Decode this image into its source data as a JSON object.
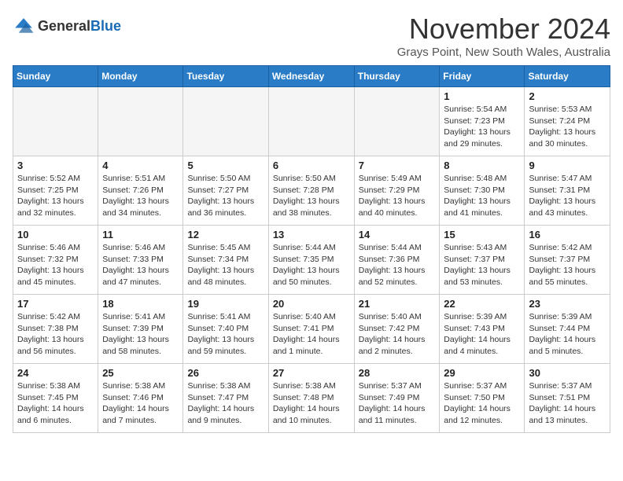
{
  "header": {
    "logo_general": "General",
    "logo_blue": "Blue",
    "month": "November 2024",
    "location": "Grays Point, New South Wales, Australia"
  },
  "weekdays": [
    "Sunday",
    "Monday",
    "Tuesday",
    "Wednesday",
    "Thursday",
    "Friday",
    "Saturday"
  ],
  "weeks": [
    [
      {
        "day": "",
        "info": ""
      },
      {
        "day": "",
        "info": ""
      },
      {
        "day": "",
        "info": ""
      },
      {
        "day": "",
        "info": ""
      },
      {
        "day": "",
        "info": ""
      },
      {
        "day": "1",
        "info": "Sunrise: 5:54 AM\nSunset: 7:23 PM\nDaylight: 13 hours\nand 29 minutes."
      },
      {
        "day": "2",
        "info": "Sunrise: 5:53 AM\nSunset: 7:24 PM\nDaylight: 13 hours\nand 30 minutes."
      }
    ],
    [
      {
        "day": "3",
        "info": "Sunrise: 5:52 AM\nSunset: 7:25 PM\nDaylight: 13 hours\nand 32 minutes."
      },
      {
        "day": "4",
        "info": "Sunrise: 5:51 AM\nSunset: 7:26 PM\nDaylight: 13 hours\nand 34 minutes."
      },
      {
        "day": "5",
        "info": "Sunrise: 5:50 AM\nSunset: 7:27 PM\nDaylight: 13 hours\nand 36 minutes."
      },
      {
        "day": "6",
        "info": "Sunrise: 5:50 AM\nSunset: 7:28 PM\nDaylight: 13 hours\nand 38 minutes."
      },
      {
        "day": "7",
        "info": "Sunrise: 5:49 AM\nSunset: 7:29 PM\nDaylight: 13 hours\nand 40 minutes."
      },
      {
        "day": "8",
        "info": "Sunrise: 5:48 AM\nSunset: 7:30 PM\nDaylight: 13 hours\nand 41 minutes."
      },
      {
        "day": "9",
        "info": "Sunrise: 5:47 AM\nSunset: 7:31 PM\nDaylight: 13 hours\nand 43 minutes."
      }
    ],
    [
      {
        "day": "10",
        "info": "Sunrise: 5:46 AM\nSunset: 7:32 PM\nDaylight: 13 hours\nand 45 minutes."
      },
      {
        "day": "11",
        "info": "Sunrise: 5:46 AM\nSunset: 7:33 PM\nDaylight: 13 hours\nand 47 minutes."
      },
      {
        "day": "12",
        "info": "Sunrise: 5:45 AM\nSunset: 7:34 PM\nDaylight: 13 hours\nand 48 minutes."
      },
      {
        "day": "13",
        "info": "Sunrise: 5:44 AM\nSunset: 7:35 PM\nDaylight: 13 hours\nand 50 minutes."
      },
      {
        "day": "14",
        "info": "Sunrise: 5:44 AM\nSunset: 7:36 PM\nDaylight: 13 hours\nand 52 minutes."
      },
      {
        "day": "15",
        "info": "Sunrise: 5:43 AM\nSunset: 7:37 PM\nDaylight: 13 hours\nand 53 minutes."
      },
      {
        "day": "16",
        "info": "Sunrise: 5:42 AM\nSunset: 7:37 PM\nDaylight: 13 hours\nand 55 minutes."
      }
    ],
    [
      {
        "day": "17",
        "info": "Sunrise: 5:42 AM\nSunset: 7:38 PM\nDaylight: 13 hours\nand 56 minutes."
      },
      {
        "day": "18",
        "info": "Sunrise: 5:41 AM\nSunset: 7:39 PM\nDaylight: 13 hours\nand 58 minutes."
      },
      {
        "day": "19",
        "info": "Sunrise: 5:41 AM\nSunset: 7:40 PM\nDaylight: 13 hours\nand 59 minutes."
      },
      {
        "day": "20",
        "info": "Sunrise: 5:40 AM\nSunset: 7:41 PM\nDaylight: 14 hours\nand 1 minute."
      },
      {
        "day": "21",
        "info": "Sunrise: 5:40 AM\nSunset: 7:42 PM\nDaylight: 14 hours\nand 2 minutes."
      },
      {
        "day": "22",
        "info": "Sunrise: 5:39 AM\nSunset: 7:43 PM\nDaylight: 14 hours\nand 4 minutes."
      },
      {
        "day": "23",
        "info": "Sunrise: 5:39 AM\nSunset: 7:44 PM\nDaylight: 14 hours\nand 5 minutes."
      }
    ],
    [
      {
        "day": "24",
        "info": "Sunrise: 5:38 AM\nSunset: 7:45 PM\nDaylight: 14 hours\nand 6 minutes."
      },
      {
        "day": "25",
        "info": "Sunrise: 5:38 AM\nSunset: 7:46 PM\nDaylight: 14 hours\nand 7 minutes."
      },
      {
        "day": "26",
        "info": "Sunrise: 5:38 AM\nSunset: 7:47 PM\nDaylight: 14 hours\nand 9 minutes."
      },
      {
        "day": "27",
        "info": "Sunrise: 5:38 AM\nSunset: 7:48 PM\nDaylight: 14 hours\nand 10 minutes."
      },
      {
        "day": "28",
        "info": "Sunrise: 5:37 AM\nSunset: 7:49 PM\nDaylight: 14 hours\nand 11 minutes."
      },
      {
        "day": "29",
        "info": "Sunrise: 5:37 AM\nSunset: 7:50 PM\nDaylight: 14 hours\nand 12 minutes."
      },
      {
        "day": "30",
        "info": "Sunrise: 5:37 AM\nSunset: 7:51 PM\nDaylight: 14 hours\nand 13 minutes."
      }
    ]
  ]
}
